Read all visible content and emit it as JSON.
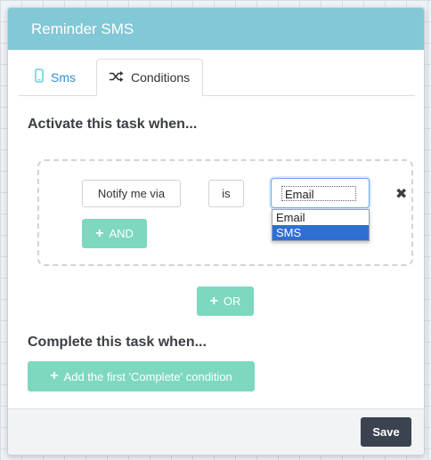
{
  "header": {
    "title": "Reminder SMS"
  },
  "tabs": [
    {
      "label": "Sms",
      "icon": "mobile-phone-icon",
      "active": false
    },
    {
      "label": "Conditions",
      "icon": "shuffle-icon",
      "active": true
    }
  ],
  "activate": {
    "title": "Activate this task when...",
    "field": "Notify me via",
    "operator": "is",
    "value": "Email",
    "options": [
      "Email",
      "SMS"
    ],
    "highlighted_option": "SMS",
    "and_label": "AND",
    "or_label": "OR"
  },
  "complete": {
    "title": "Complete this task when...",
    "add_label": "Add the first 'Complete' condition"
  },
  "footer": {
    "save_label": "Save"
  },
  "colors": {
    "header_bg": "#82c8d6",
    "green_button": "#7dd8bf",
    "save_button": "#3b4350",
    "tab_link": "#2f8fd0",
    "dropdown_highlight": "#2f6fd1"
  }
}
